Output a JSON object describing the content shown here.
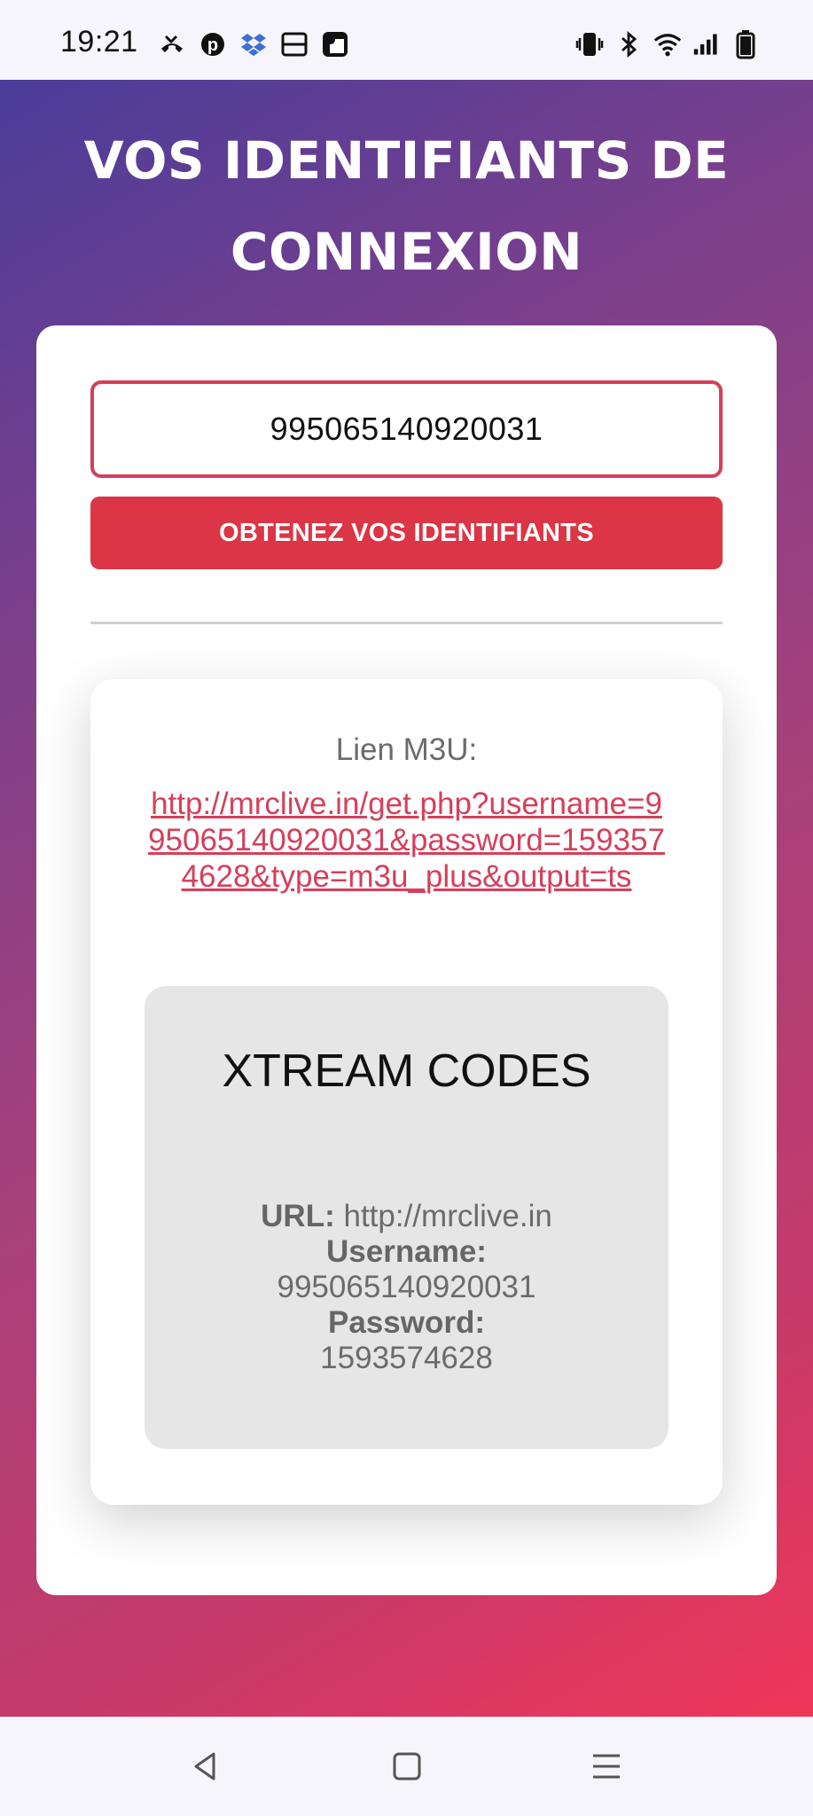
{
  "status_bar": {
    "time": "19:21",
    "left_icons": [
      "missed-call-icon",
      "pinterest-icon",
      "dropbox-icon",
      "printer-icon",
      "app-icon"
    ],
    "right_icons": [
      "vibrate-icon",
      "bluetooth-icon",
      "wifi-icon",
      "signal-icon",
      "battery-icon"
    ]
  },
  "page": {
    "title": "VOS IDENTIFIANTS DE CONNEXION",
    "code_input_value": "995065140920031",
    "submit_label": "OBTENEZ VOS IDENTIFIANTS"
  },
  "result": {
    "m3u_label": "Lien M3U:",
    "m3u_link": "http://mrclive.in/get.php?username=995065140920031&password=1593574628&type=m3u_plus&output=ts",
    "xtream": {
      "title": "XTREAM CODES",
      "url_label": "URL:",
      "url_value": "http://mrclive.in",
      "username_label": "Username:",
      "username_value": "995065140920031",
      "password_label": "Password:",
      "password_value": "1593574628"
    }
  },
  "nav_bar": {
    "buttons": [
      "back-icon",
      "home-icon",
      "menu-icon"
    ]
  },
  "colors": {
    "accent": "#dc3545",
    "link": "#d63f5b",
    "gradient_start": "#4a3d99",
    "gradient_end": "#f03658"
  }
}
